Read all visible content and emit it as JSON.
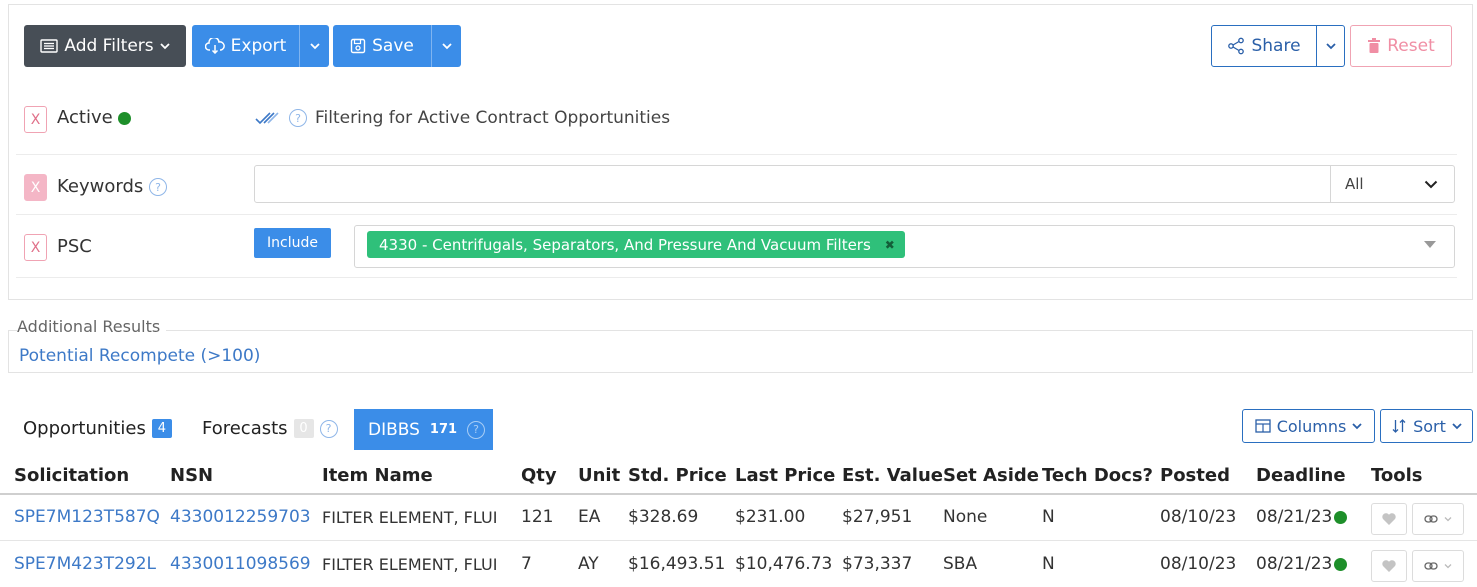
{
  "toolbar": {
    "add_filters": "Add Filters",
    "export": "Export",
    "save": "Save",
    "share": "Share",
    "reset": "Reset"
  },
  "filters": {
    "active": {
      "remove": "X",
      "label": "Active",
      "description": "Filtering for Active Contract Opportunities"
    },
    "keywords": {
      "remove": "X",
      "label": "Keywords",
      "value": "",
      "placeholder": "",
      "scope": "All"
    },
    "psc": {
      "remove": "X",
      "label": "PSC",
      "mode": "Include",
      "tags": [
        "4330 - Centrifugals, Separators, And Pressure And Vacuum Filters"
      ]
    }
  },
  "additional_results": {
    "legend": "Additional Results",
    "link": "Potential Recompete (>100)"
  },
  "tabs": [
    {
      "label": "Opportunities",
      "count": "4"
    },
    {
      "label": "Forecasts",
      "count": "0"
    },
    {
      "label": "DIBBS",
      "count": "171"
    }
  ],
  "view_controls": {
    "columns": "Columns",
    "sort": "Sort"
  },
  "table": {
    "headers": [
      "Solicitation",
      "NSN",
      "Item Name",
      "Qty",
      "Unit",
      "Std. Price",
      "Last Price",
      "Est. Value",
      "Set Aside",
      "Tech Docs?",
      "Posted",
      "Deadline",
      "Tools"
    ],
    "rows": [
      {
        "solicitation": "SPE7M123T587Q",
        "nsn": "4330012259703",
        "item": "FILTER ELEMENT, FLUI",
        "qty": "121",
        "unit": "EA",
        "std_price": "$328.69",
        "last_price": "$231.00",
        "est_value": "$27,951",
        "set_aside": "None",
        "tech_docs": "N",
        "posted": "08/10/23",
        "deadline": "08/21/23"
      },
      {
        "solicitation": "SPE7M423T292L",
        "nsn": "4330011098569",
        "item": "FILTER ELEMENT, FLUI",
        "qty": "7",
        "unit": "AY",
        "std_price": "$16,493.51",
        "last_price": "$10,476.73",
        "est_value": "$73,337",
        "set_aside": "SBA",
        "tech_docs": "N",
        "posted": "08/10/23",
        "deadline": "08/21/23"
      }
    ]
  },
  "colors": {
    "primary": "#3b8de8",
    "dark": "#474e56",
    "tag": "#2fc07a",
    "status_active": "#1e8f2a",
    "danger": "#f08ea4",
    "link": "#3d79c7"
  }
}
